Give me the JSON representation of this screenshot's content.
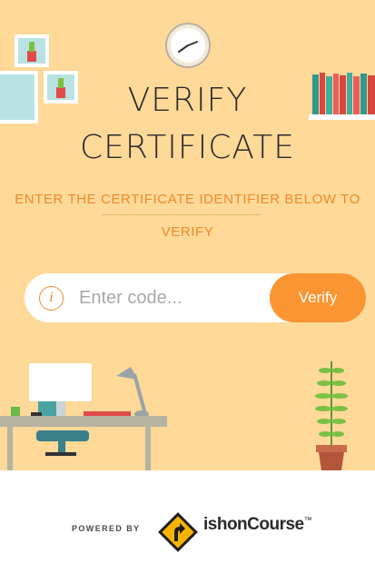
{
  "hero": {
    "title_line1": "VERIFY",
    "title_line2": "CERTIFICATE",
    "subtitle_line1": "ENTER THE CERTIFICATE IDENTIFIER BELOW TO",
    "subtitle_line2": "VERIFY"
  },
  "search": {
    "info_icon_glyph": "i",
    "placeholder": "Enter code...",
    "value": "",
    "button_label": "Verify"
  },
  "footer": {
    "powered_by": "POWERED BY",
    "brand_prefix": "ish",
    "brand_name": "onCourse",
    "brand_mark": "™"
  },
  "colors": {
    "background": "#fed998",
    "accent": "#fb9532",
    "subtitle": "#f08a2c",
    "title": "#2b2b2b",
    "footer": "#ffffff"
  },
  "icons": [
    "clock-icon",
    "plant-frame-icon",
    "books-icon",
    "desk-icon",
    "monitor-icon",
    "lamp-icon",
    "potted-plant-icon",
    "info-icon",
    "road-sign-logo-icon"
  ]
}
